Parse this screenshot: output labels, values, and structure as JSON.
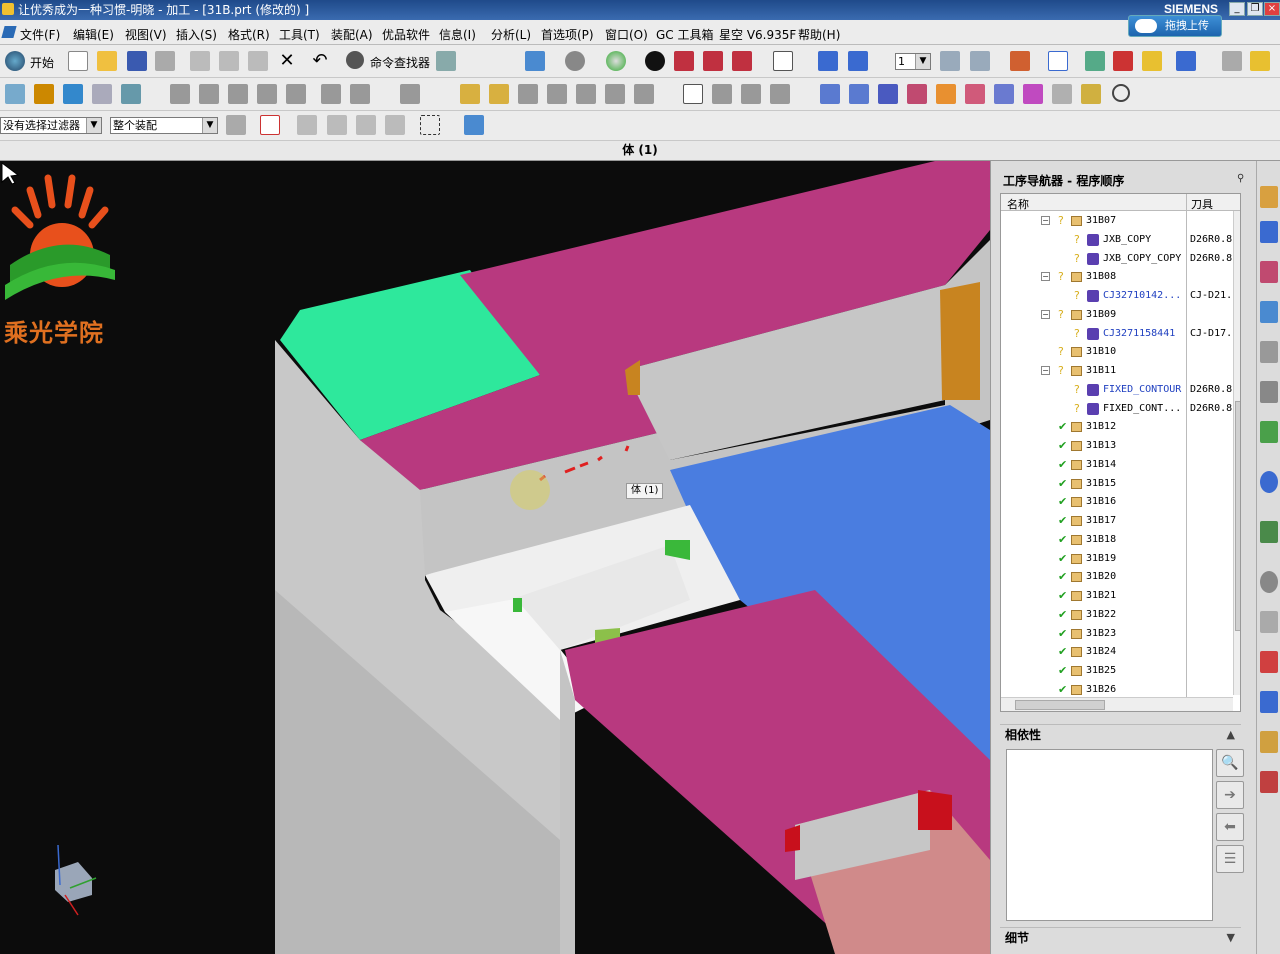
{
  "window": {
    "title": "让优秀成为一种习惯-明晓 - 加工 - [31B.prt (修改的) ]",
    "brand": "SIEMENS",
    "upload_label": "拖拽上传",
    "minimize": "_",
    "restore": "❐",
    "close": "×"
  },
  "menu": {
    "items": [
      "文件(F)",
      "编辑(E)",
      "视图(V)",
      "插入(S)",
      "格式(R)",
      "工具(T)",
      "装配(A)",
      "优品软件",
      "信息(I)",
      "分析(L)",
      "首选项(P)",
      "窗口(O)",
      "GC 工具箱",
      "星空 V6.935F",
      "帮助(H)"
    ]
  },
  "toolbar": {
    "start_label": "开始",
    "command_finder_label": "命令查找器",
    "layer_value": "1",
    "selection_filter": "没有选择过滤器",
    "assembly_scope": "整个装配"
  },
  "document": {
    "body_label": "体 (1)"
  },
  "viewport": {
    "logo_text": "乘光学院",
    "hover_tip": "体 (1)",
    "colors": {
      "background": "#0c0c0c",
      "gray_face": "#c8c8c8",
      "magenta_face": "#b8397f",
      "green_face": "#2ee89c",
      "blue_face": "#4a7de0",
      "orange_fillet": "#c88420"
    }
  },
  "navigator": {
    "title": "工序导航器 - 程序顺序",
    "columns": [
      "名称",
      "刀具"
    ],
    "rows": [
      {
        "level": 1,
        "expand": "−",
        "mark": "?",
        "icon": "folder",
        "name": "31B07",
        "tool": ""
      },
      {
        "level": 2,
        "expand": "",
        "mark": "?",
        "icon": "op",
        "name": "JXB_COPY",
        "tool": "D26R0.8"
      },
      {
        "level": 2,
        "expand": "",
        "mark": "?",
        "icon": "op",
        "name": "JXB_COPY_COPY",
        "tool": "D26R0.8"
      },
      {
        "level": 1,
        "expand": "−",
        "mark": "?",
        "icon": "folder",
        "name": "31B08",
        "tool": ""
      },
      {
        "level": 2,
        "expand": "",
        "mark": "?",
        "icon": "op",
        "name": "CJ32710142...",
        "tool": "CJ-D21...",
        "blue": true
      },
      {
        "level": 1,
        "expand": "−",
        "mark": "?",
        "icon": "folder",
        "name": "31B09",
        "tool": ""
      },
      {
        "level": 2,
        "expand": "",
        "mark": "?",
        "icon": "op",
        "name": "CJ3271158441",
        "tool": "CJ-D17...",
        "blue": true
      },
      {
        "level": 1,
        "expand": "",
        "mark": "?",
        "icon": "folder",
        "name": "31B10",
        "tool": ""
      },
      {
        "level": 1,
        "expand": "−",
        "mark": "?",
        "icon": "folder",
        "name": "31B11",
        "tool": ""
      },
      {
        "level": 2,
        "expand": "",
        "mark": "?",
        "icon": "op",
        "name": "FIXED_CONTOUR",
        "tool": "D26R0.8",
        "blue": true
      },
      {
        "level": 2,
        "expand": "",
        "mark": "?",
        "icon": "op",
        "name": "FIXED_CONT...",
        "tool": "D26R0.8"
      },
      {
        "level": 1,
        "expand": "",
        "mark": "✔",
        "icon": "folder",
        "name": "31B12",
        "tool": ""
      },
      {
        "level": 1,
        "expand": "",
        "mark": "✔",
        "icon": "folder",
        "name": "31B13",
        "tool": ""
      },
      {
        "level": 1,
        "expand": "",
        "mark": "✔",
        "icon": "folder",
        "name": "31B14",
        "tool": ""
      },
      {
        "level": 1,
        "expand": "",
        "mark": "✔",
        "icon": "folder",
        "name": "31B15",
        "tool": ""
      },
      {
        "level": 1,
        "expand": "",
        "mark": "✔",
        "icon": "folder",
        "name": "31B16",
        "tool": ""
      },
      {
        "level": 1,
        "expand": "",
        "mark": "✔",
        "icon": "folder",
        "name": "31B17",
        "tool": ""
      },
      {
        "level": 1,
        "expand": "",
        "mark": "✔",
        "icon": "folder",
        "name": "31B18",
        "tool": ""
      },
      {
        "level": 1,
        "expand": "",
        "mark": "✔",
        "icon": "folder",
        "name": "31B19",
        "tool": ""
      },
      {
        "level": 1,
        "expand": "",
        "mark": "✔",
        "icon": "folder",
        "name": "31B20",
        "tool": ""
      },
      {
        "level": 1,
        "expand": "",
        "mark": "✔",
        "icon": "folder",
        "name": "31B21",
        "tool": ""
      },
      {
        "level": 1,
        "expand": "",
        "mark": "✔",
        "icon": "folder",
        "name": "31B22",
        "tool": ""
      },
      {
        "level": 1,
        "expand": "",
        "mark": "✔",
        "icon": "folder",
        "name": "31B23",
        "tool": ""
      },
      {
        "level": 1,
        "expand": "",
        "mark": "✔",
        "icon": "folder",
        "name": "31B24",
        "tool": ""
      },
      {
        "level": 1,
        "expand": "",
        "mark": "✔",
        "icon": "folder",
        "name": "31B25",
        "tool": ""
      },
      {
        "level": 1,
        "expand": "",
        "mark": "✔",
        "icon": "folder",
        "name": "31B26",
        "tool": ""
      }
    ],
    "dependencies_label": "相依性",
    "details_label": "细节",
    "dep_buttons": [
      "magnifier-icon",
      "arrow-right-icon",
      "arrow-left-icon",
      "list-icon"
    ]
  }
}
